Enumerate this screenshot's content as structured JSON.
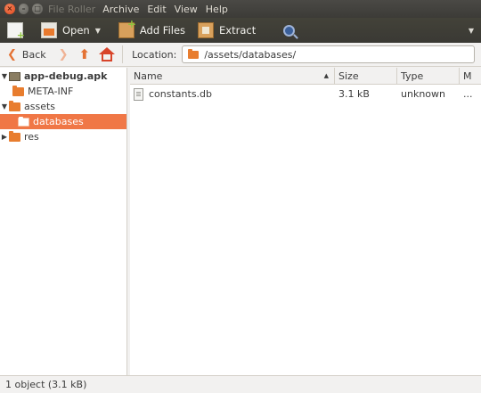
{
  "window": {
    "title": "app-debug.apk"
  },
  "menubar": {
    "app_title": "File Roller",
    "items": [
      "Archive",
      "Edit",
      "View",
      "Help"
    ]
  },
  "toolbar": {
    "open_label": "Open",
    "add_files_label": "Add Files",
    "extract_label": "Extract"
  },
  "navigation": {
    "back_label": "Back",
    "location_label": "Location:",
    "location_value": "/assets/databases/"
  },
  "sidebar": {
    "items": [
      {
        "label": "app-debug.apk",
        "expanded": true,
        "selected": false,
        "icon": "archive-icon"
      },
      {
        "label": "META-INF",
        "expanded": false,
        "selected": false,
        "icon": "folder-icon"
      },
      {
        "label": "assets",
        "expanded": true,
        "selected": false,
        "icon": "folder-icon"
      },
      {
        "label": "databases",
        "expanded": false,
        "selected": true,
        "icon": "folder-icon"
      },
      {
        "label": "res",
        "expanded": false,
        "selected": false,
        "icon": "folder-icon"
      }
    ]
  },
  "filelist": {
    "columns": [
      "Name",
      "Size",
      "Type",
      "M"
    ],
    "rows": [
      {
        "name": "constants.db",
        "size": "3.1 kB",
        "type": "unknown",
        "more": "..."
      }
    ]
  },
  "statusbar": {
    "text": "1 object (3.1 kB)"
  },
  "colors": {
    "accent": "#f07746",
    "folder": "#e87d2f",
    "titlebar": "#3c3b37"
  }
}
